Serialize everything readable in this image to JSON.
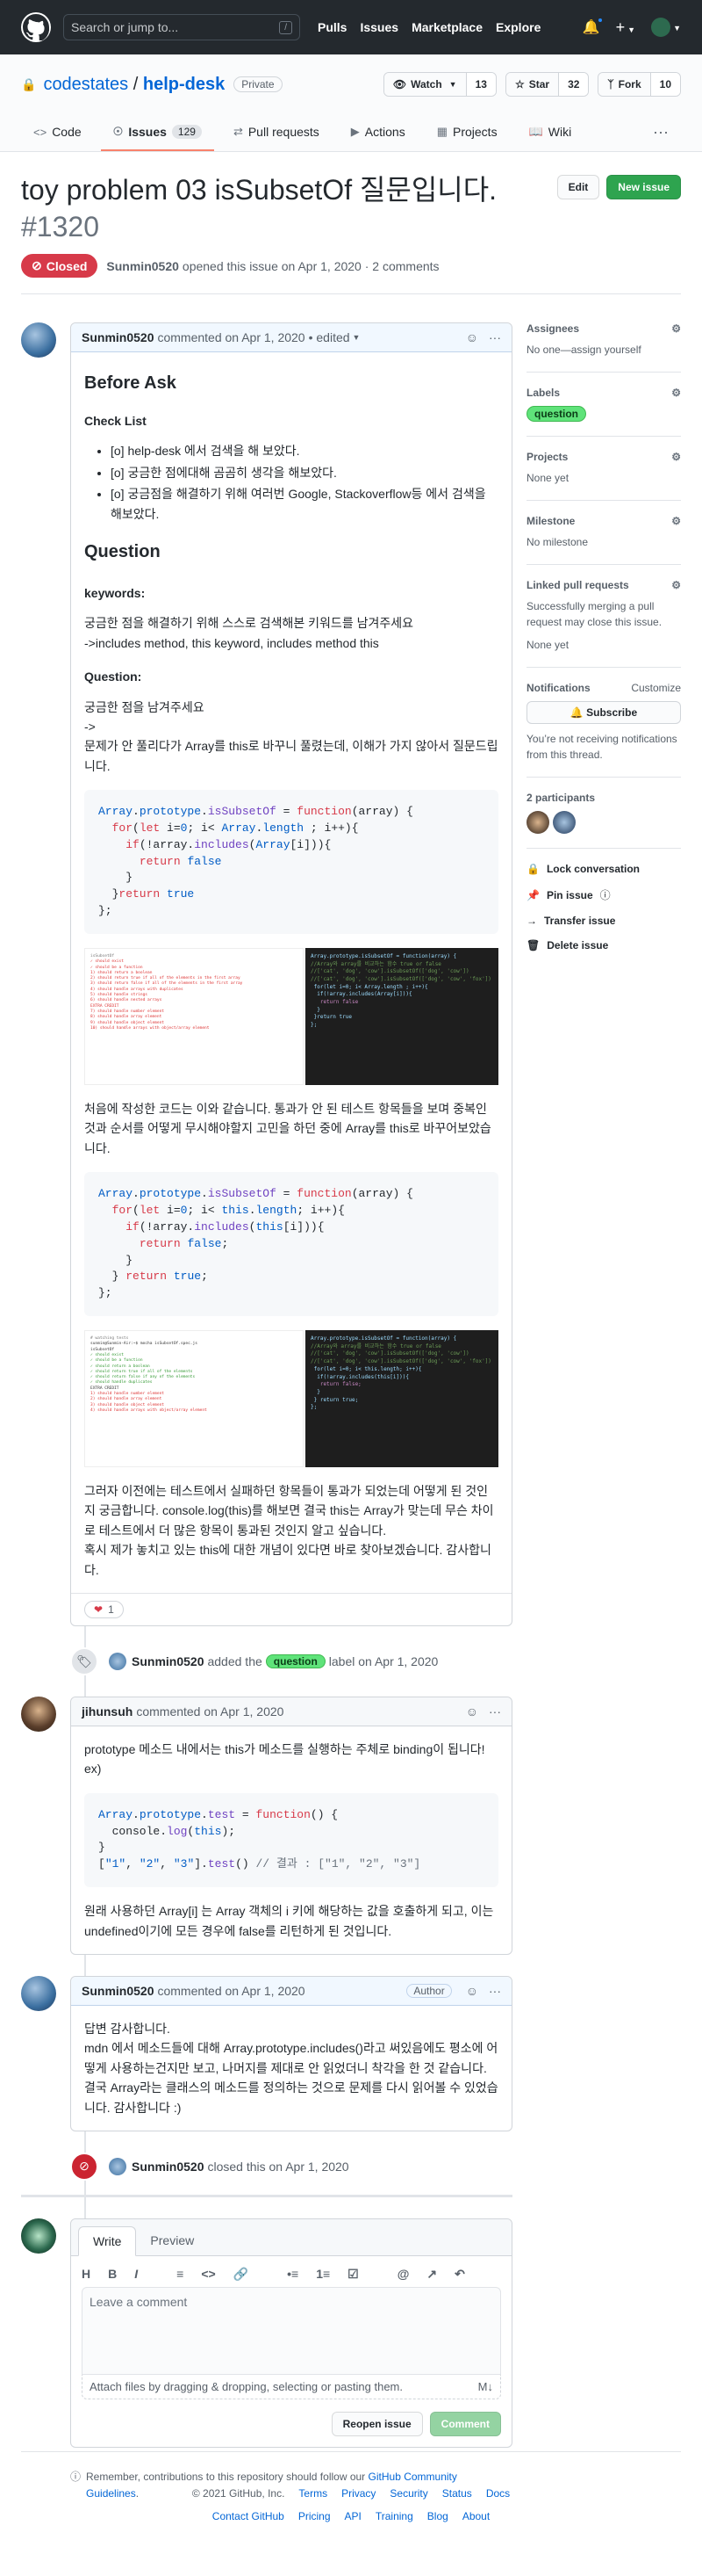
{
  "header": {
    "search_placeholder": "Search or jump to...",
    "slash": "/",
    "nav": [
      "Pulls",
      "Issues",
      "Marketplace",
      "Explore"
    ]
  },
  "repo": {
    "owner": "codestates",
    "sep": "/",
    "name": "help-desk",
    "visibility": "Private",
    "watch_label": "Watch",
    "watch_count": "13",
    "star_label": "Star",
    "star_count": "32",
    "fork_label": "Fork",
    "fork_count": "10",
    "tabs": [
      {
        "label": "Code"
      },
      {
        "label": "Issues",
        "count": "129"
      },
      {
        "label": "Pull requests"
      },
      {
        "label": "Actions"
      },
      {
        "label": "Projects"
      },
      {
        "label": "Wiki"
      }
    ]
  },
  "issue": {
    "title": "toy problem 03 isSubsetOf 질문입니다.",
    "number": "#1320",
    "edit": "Edit",
    "new_issue": "New issue",
    "state": "Closed",
    "author": "Sunmin0520",
    "meta_text": "opened this issue on Apr 1, 2020 · 2 comments"
  },
  "comment1": {
    "author": "Sunmin0520",
    "meta": "commented on Apr 1, 2020",
    "edited": "• edited",
    "h_before": "Before Ask",
    "h_check": "Check List",
    "checklist": [
      "[o] help-desk 에서 검색을 해 보았다.",
      "[o] 궁금한 점에대해 곰곰히 생각을 해보았다.",
      "[o] 궁금점을 해결하기 위해 여러번 Google, Stackoverflow등 에서 검색을 해보았다."
    ],
    "h_question": "Question",
    "h_keywords": "keywords:",
    "kw_text1": "궁금한 점을 해결하기 위해 스스로 검색해본 키워드를 남겨주세요",
    "kw_text2": "->includes method, this keyword, includes method this",
    "h_q2": "Question:",
    "q_text1": "궁금한 점을 남겨주세요",
    "q_text2": "->",
    "q_text3": "문제가 안 풀리다가 Array를 this로 바꾸니 풀렸는데, 이해가 가지 않아서 질문드립니다.",
    "mid_text": "처음에 작성한 코드는 이와 같습니다. 통과가 안 된 테스트 항목들을 보며 중복인 것과 순서를 어떻게 무시해야할지 고민을 하던 중에 Array를 this로 바꾸어보았습니다.",
    "end_text1": "그러자 이전에는 테스트에서 실패하던 항목들이 통과가 되었는데 어떻게 된 것인지 궁금합니다. console.log(this)를 해보면 결국 this는 Array가 맞는데 무슨 차이로 테스트에서 더 많은 항목이 통과된 것인지 알고 싶습니다.",
    "end_text2": "혹시 제가 놓치고 있는 this에 대한 개념이 있다면 바로 찾아보겠습니다. 감사합니다.",
    "reaction": "1"
  },
  "event_label": {
    "author": "Sunmin0520",
    "pre": "added the",
    "label": "question",
    "post": "label on Apr 1, 2020"
  },
  "comment2": {
    "author": "jihunsuh",
    "meta": "commented on Apr 1, 2020",
    "text1": "prototype 메소드 내에서는 this가 메소드를 실행하는 주체로 binding이 됩니다!",
    "text2": "ex)",
    "text3": "원래 사용하던 Array[i] 는 Array 객체의 i 키에 해당하는 값을 호출하게 되고, 이는 undefined이기에 모든 경우에 false를 리턴하게 된 것입니다."
  },
  "comment3": {
    "author": "Sunmin0520",
    "meta": "commented on Apr 1, 2020",
    "badge": "Author",
    "text": "답변 감사합니다.\nmdn 에서 메소드들에 대해 Array.prototype.includes()라고 써있음에도 평소에 어떻게 사용하는건지만 보고, 나머지를 제대로 안 읽었더니 착각을 한 것 같습니다. 결국 Array라는 클래스의 메소드를 정의하는 것으로 문제를 다시 읽어볼 수 있었습니다. 감사합니다 :)"
  },
  "event_closed": {
    "author": "Sunmin0520",
    "text": "closed this on Apr 1, 2020"
  },
  "editor": {
    "tab_write": "Write",
    "tab_preview": "Preview",
    "placeholder": "Leave a comment",
    "attach": "Attach files by dragging & dropping, selecting or pasting them.",
    "reopen": "Reopen issue",
    "comment": "Comment",
    "note_pre": "Remember, contributions to this repository should follow our",
    "note_link": "GitHub Community Guidelines",
    "note_post": "."
  },
  "sidebar": {
    "assignees_h": "Assignees",
    "assignees": "No one—assign yourself",
    "labels_h": "Labels",
    "label": "question",
    "projects_h": "Projects",
    "projects": "None yet",
    "milestone_h": "Milestone",
    "milestone": "No milestone",
    "linked_h": "Linked pull requests",
    "linked": "Successfully merging a pull request may close this issue.",
    "linked2": "None yet",
    "notif_h": "Notifications",
    "customize": "Customize",
    "subscribe": "Subscribe",
    "notif_text": "You’re not receiving notifications from this thread.",
    "participants_h": "2 participants",
    "lock": "Lock conversation",
    "pin": "Pin issue",
    "transfer": "Transfer issue",
    "delete": "Delete issue"
  },
  "footer": {
    "copy": "© 2021 GitHub, Inc.",
    "row1": [
      "Terms",
      "Privacy",
      "Security",
      "Status",
      "Docs"
    ],
    "row2": [
      "Contact GitHub",
      "Pricing",
      "API",
      "Training",
      "Blog",
      "About"
    ]
  }
}
